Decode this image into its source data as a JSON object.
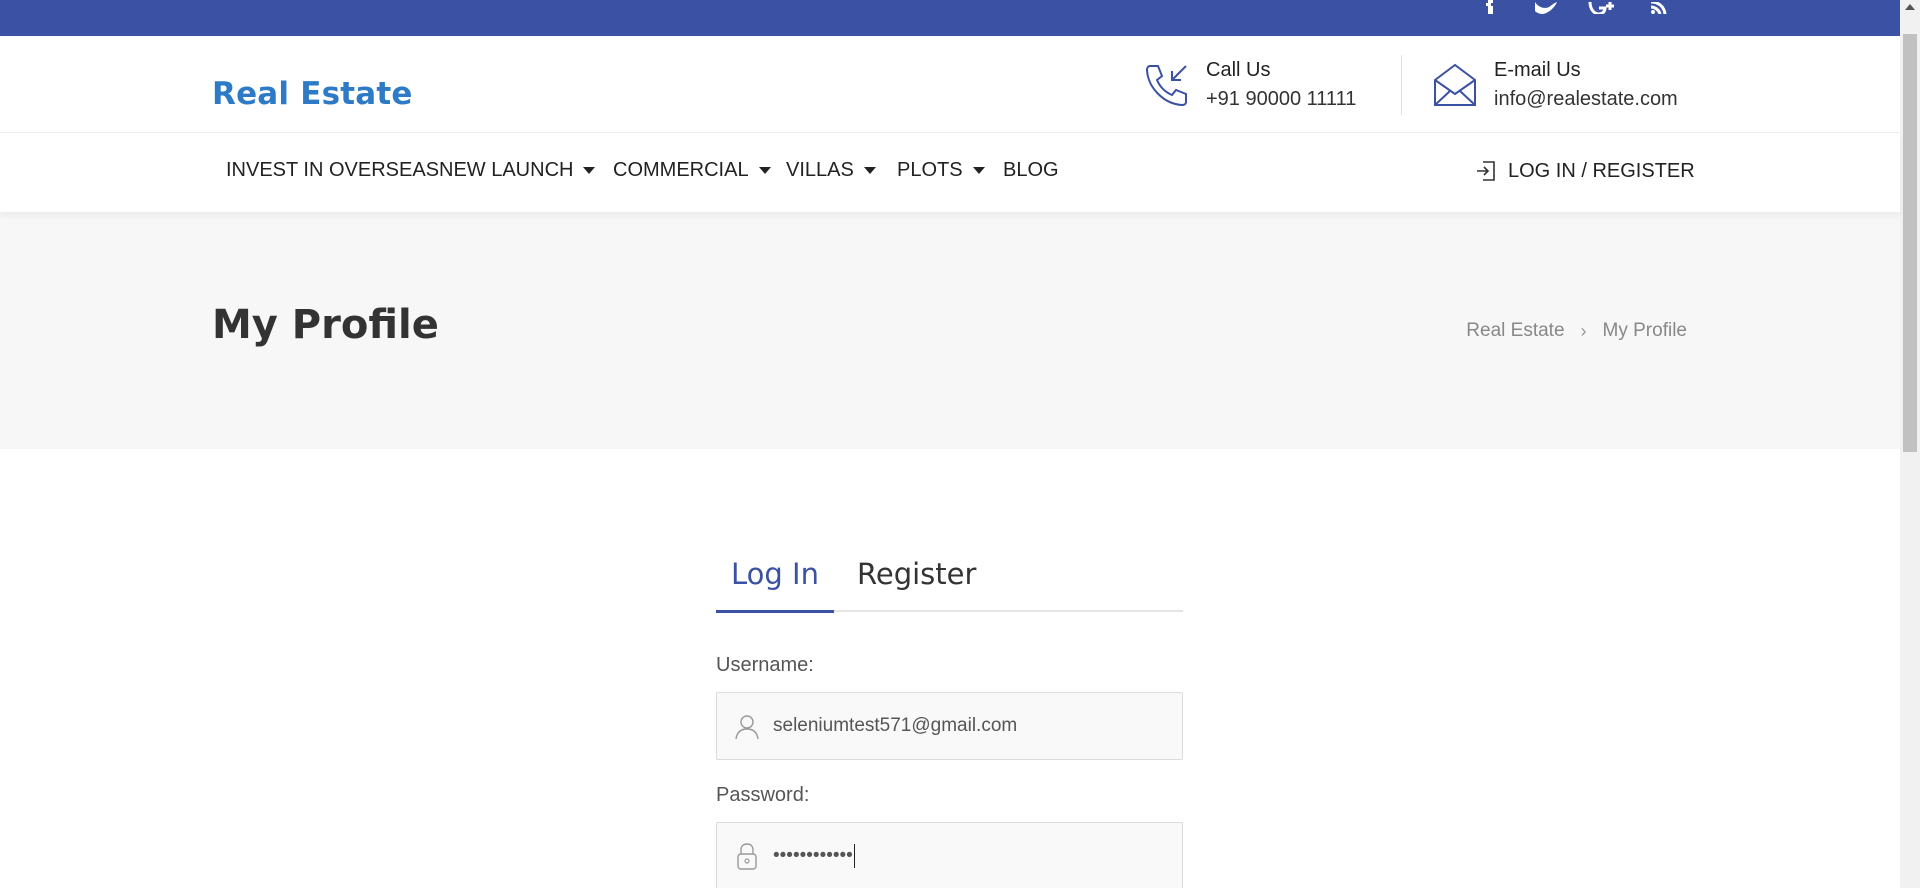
{
  "social_icons": [
    "facebook-icon",
    "twitter-icon",
    "google-plus-icon",
    "rss-icon"
  ],
  "header": {
    "logo": "Real Estate",
    "call": {
      "title": "Call Us",
      "value": "+91 90000 11111",
      "icon": "phone-incoming-icon"
    },
    "email": {
      "title": "E-mail Us",
      "value": "info@realestate.com",
      "icon": "envelope-open-icon"
    }
  },
  "nav": {
    "items": [
      {
        "label": "INVEST IN OVERSEAS",
        "dropdown": false
      },
      {
        "label": "NEW LAUNCH",
        "dropdown": true
      },
      {
        "label": "COMMERCIAL",
        "dropdown": true
      },
      {
        "label": "VILLAS",
        "dropdown": true
      },
      {
        "label": "PLOTS",
        "dropdown": true
      },
      {
        "label": "BLOG",
        "dropdown": false
      }
    ],
    "login_label": "LOG IN / REGISTER"
  },
  "title_band": {
    "title": "My Profile",
    "breadcrumb": [
      "Real Estate",
      "My Profile"
    ],
    "breadcrumb_separator": "›"
  },
  "form": {
    "tabs": [
      "Log In",
      "Register"
    ],
    "active_tab": "Log In",
    "username_label": "Username:",
    "username_value": "seleniumtest571@gmail.com",
    "password_label": "Password:",
    "password_value": "••••••••••••"
  },
  "colors": {
    "topbar": "#3b51a3",
    "logo": "#2d7ac7",
    "accent": "#3b51a3",
    "band": "#f7f7f7"
  }
}
